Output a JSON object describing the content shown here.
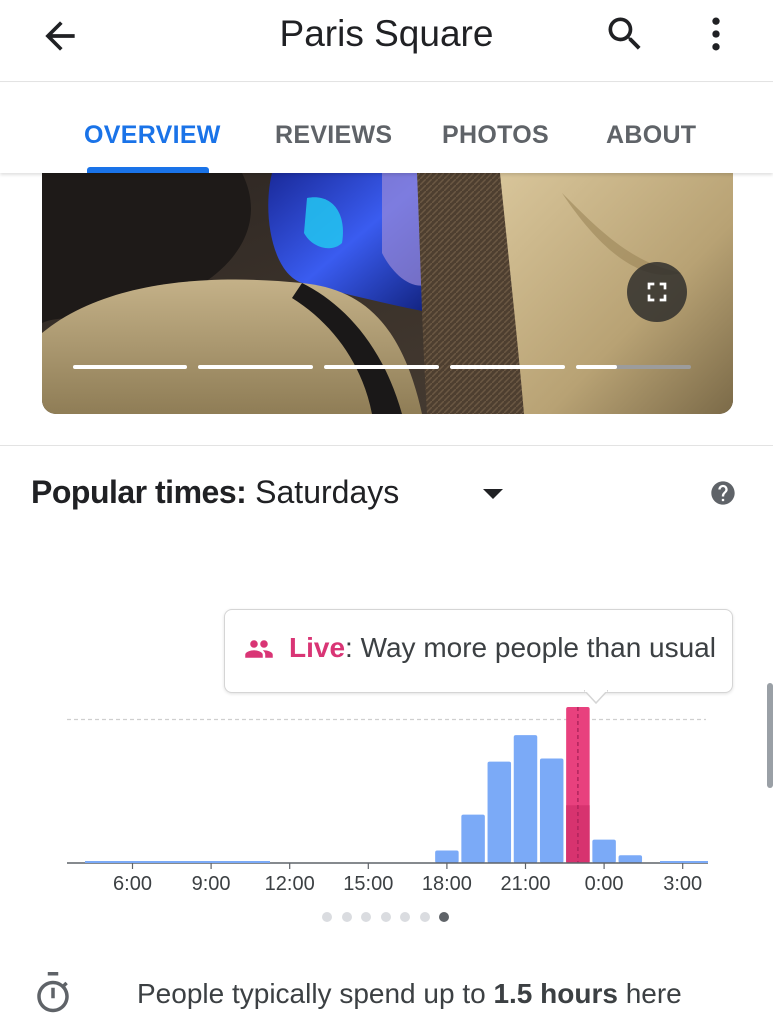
{
  "app_bar": {
    "title": "Paris Square",
    "back_icon": "arrow-back-icon",
    "search_icon": "search-icon",
    "more_icon": "more-vert-icon"
  },
  "tabs": [
    {
      "label": "OVERVIEW",
      "active": true
    },
    {
      "label": "REVIEWS",
      "active": false
    },
    {
      "label": "PHOTOS",
      "active": false
    },
    {
      "label": "ABOUT",
      "active": false
    }
  ],
  "photo": {
    "expand_icon": "fullscreen-icon",
    "story_segments": 5,
    "story_progress_last_segment": 0.36
  },
  "popular_times": {
    "label": "Popular times:",
    "day": "Saturdays",
    "dropdown_icon": "arrow-drop-down-icon",
    "help_icon": "help-icon",
    "live": {
      "icon": "people-icon",
      "label": "Live",
      "separator": ":",
      "text": " Way more people than usual"
    }
  },
  "chart_data": {
    "type": "bar",
    "x_tick_labels": [
      "6:00",
      "9:00",
      "12:00",
      "15:00",
      "18:00",
      "21:00",
      "0:00",
      "3:00"
    ],
    "categories": [
      "4:00",
      "5:00",
      "6:00",
      "7:00",
      "8:00",
      "9:00",
      "10:00",
      "11:00",
      "12:00",
      "13:00",
      "14:00",
      "15:00",
      "16:00",
      "17:00",
      "18:00",
      "19:00",
      "20:00",
      "21:00",
      "22:00",
      "23:00",
      "0:00",
      "1:00",
      "2:00",
      "3:00"
    ],
    "series": [
      {
        "values": [
          0,
          0,
          0,
          0,
          0,
          0,
          0,
          0,
          0,
          0,
          0,
          0,
          0,
          0,
          8,
          31,
          65,
          82,
          67,
          37,
          15,
          5,
          0,
          0
        ]
      }
    ],
    "live_index": 19,
    "live_value": 100,
    "usual_line": 92,
    "ylim": [
      0,
      100
    ],
    "colors": {
      "bar": "#7baaf7",
      "live": "#e8417e",
      "live_usual": "#d7336f",
      "axis": "#7baaf7"
    }
  },
  "pager": {
    "count": 7,
    "active": 6
  },
  "visit_duration": {
    "icon": "timer-icon",
    "before": "People typically spend up to ",
    "bold": "1.5 hours",
    "after": " here"
  }
}
